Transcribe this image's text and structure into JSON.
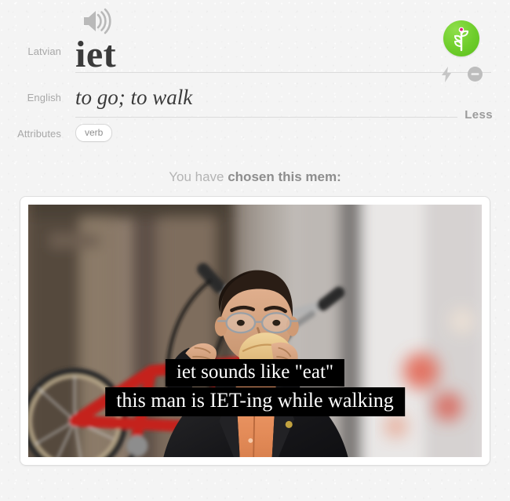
{
  "word_entry": {
    "source_label": "Latvian",
    "word": "iet",
    "target_label": "English",
    "meaning": "to go; to walk",
    "attributes_label": "Attributes",
    "attributes": [
      "verb"
    ],
    "less_label": "Less",
    "audio_icon": "speaker-icon",
    "growth_icon": "plant-growth-icon",
    "bolt_icon": "lightning-bolt-icon",
    "ignore_icon": "ignore-minus-icon",
    "accent_green": "#6ecd2b",
    "flower_pink": "#e0177a",
    "label_color": "#a8a8a8",
    "word_color": "#3a3a3a"
  },
  "mem": {
    "heading_prefix": "You have ",
    "heading_emphasis": "chosen this mem:",
    "caption_line_1": "iet sounds like \"eat\"",
    "caption_line_2": "this man is IET-ing while walking",
    "photo_alt": "Man in black suit and orange shirt carrying a red bicycle on his shoulder while eating a sandwich on a city street"
  }
}
